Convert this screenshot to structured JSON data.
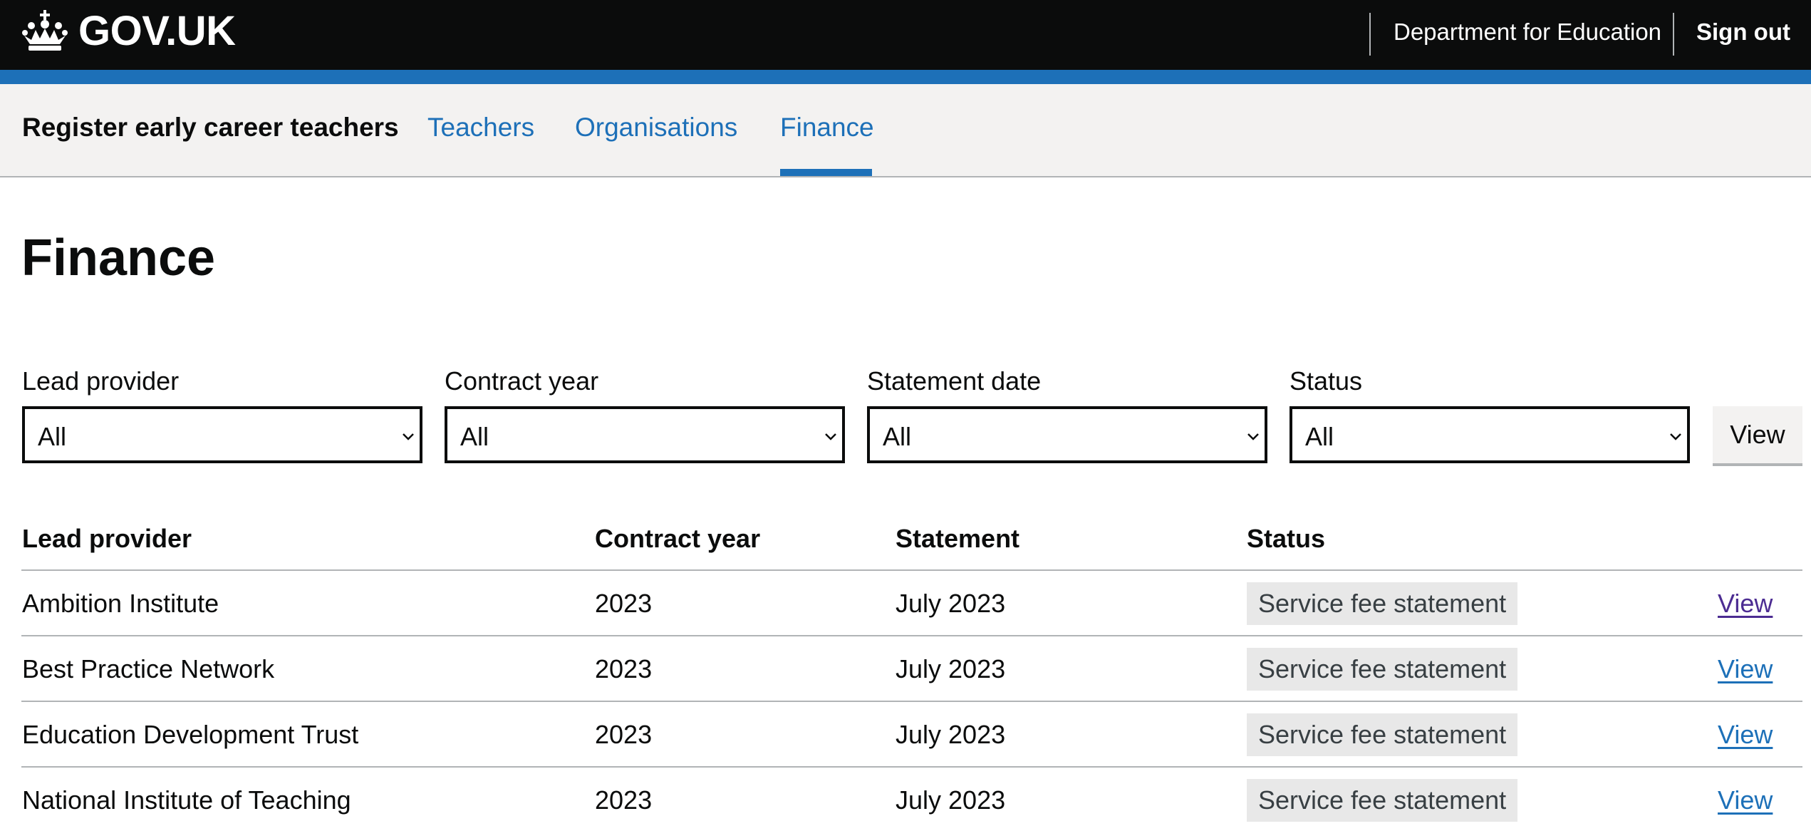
{
  "header": {
    "logo_text": "GOV.UK",
    "logo_icon": "crown-icon",
    "department": "Department for Education",
    "sign_out": "Sign out"
  },
  "service_nav": {
    "service_name": "Register early career teachers",
    "links": [
      {
        "label": "Teachers"
      },
      {
        "label": "Organisations"
      },
      {
        "label": "Finance",
        "active": true
      }
    ]
  },
  "page": {
    "title": "Finance"
  },
  "filters": {
    "items": [
      {
        "label": "Lead provider",
        "value": "All"
      },
      {
        "label": "Contract year",
        "value": "All"
      },
      {
        "label": "Statement date",
        "value": "All"
      },
      {
        "label": "Status",
        "value": "All"
      }
    ],
    "submit_label": "View"
  },
  "table": {
    "headers": [
      "Lead provider",
      "Contract year",
      "Statement",
      "Status"
    ],
    "rows": [
      {
        "lead_provider": "Ambition Institute",
        "contract_year": "2023",
        "statement": "July 2023",
        "status": "Service fee statement",
        "action": "View",
        "visited": true
      },
      {
        "lead_provider": "Best Practice Network",
        "contract_year": "2023",
        "statement": "July 2023",
        "status": "Service fee statement",
        "action": "View"
      },
      {
        "lead_provider": "Education Development Trust",
        "contract_year": "2023",
        "statement": "July 2023",
        "status": "Service fee statement",
        "action": "View"
      },
      {
        "lead_provider": "National Institute of Teaching",
        "contract_year": "2023",
        "statement": "July 2023",
        "status": "Service fee statement",
        "action": "View"
      }
    ]
  },
  "colors": {
    "header_bg": "#0b0c0c",
    "brand_blue": "#1d70b8",
    "link_visited": "#4c2c92",
    "nav_bg": "#f3f2f1",
    "tag_bg": "#e8e8e8"
  }
}
